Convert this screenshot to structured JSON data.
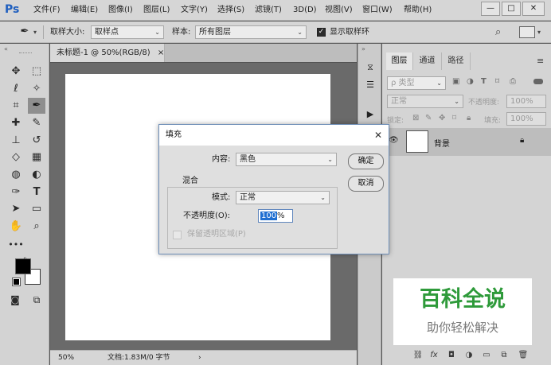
{
  "app": {
    "logo": "Ps"
  },
  "menu": {
    "items": [
      "文件(F)",
      "编辑(E)",
      "图像(I)",
      "图层(L)",
      "文字(Y)",
      "选择(S)",
      "滤镜(T)",
      "3D(D)",
      "视图(V)",
      "窗口(W)",
      "帮助(H)"
    ]
  },
  "window_controls": {
    "minimize": "—",
    "restore": "□",
    "close": "✕"
  },
  "options": {
    "sample_size_label": "取样大小:",
    "sample_size_value": "取样点",
    "sample_label": "样本:",
    "sample_value": "所有图层",
    "show_ring_label": "显示取样环",
    "show_ring_checked": true
  },
  "document": {
    "tab_title": "未标题-1 @ 50%(RGB/8)",
    "tab_close": "×",
    "zoom": "50%",
    "doc_info": "文档:1.83M/0 字节",
    "status_arrow": "›"
  },
  "layers_panel": {
    "tabs": [
      "图层",
      "通道",
      "路径"
    ],
    "kind_filter": "ρ 类型",
    "blend_mode": "正常",
    "opacity_label": "不透明度:",
    "opacity_value": "100%",
    "lock_label": "锁定:",
    "fill_label": "填充:",
    "fill_value": "100%",
    "layer_name": "背景"
  },
  "watermark": {
    "title": "百科全说",
    "subtitle": "助你轻松解决"
  },
  "dialog": {
    "title": "填充",
    "close": "✕",
    "content_label": "内容:",
    "content_value": "黑色",
    "ok": "确定",
    "cancel": "取消",
    "blend_group": "混合",
    "mode_label": "模式:",
    "mode_value": "正常",
    "opacity_label": "不透明度(O):",
    "opacity_value": "100",
    "opacity_unit": "%",
    "preserve_label": "保留透明区域(P)"
  },
  "colors": {
    "foreground": "#000000",
    "background": "#ffffff",
    "accent": "#1f5fbf",
    "watermark_green": "#2e9a3a"
  }
}
